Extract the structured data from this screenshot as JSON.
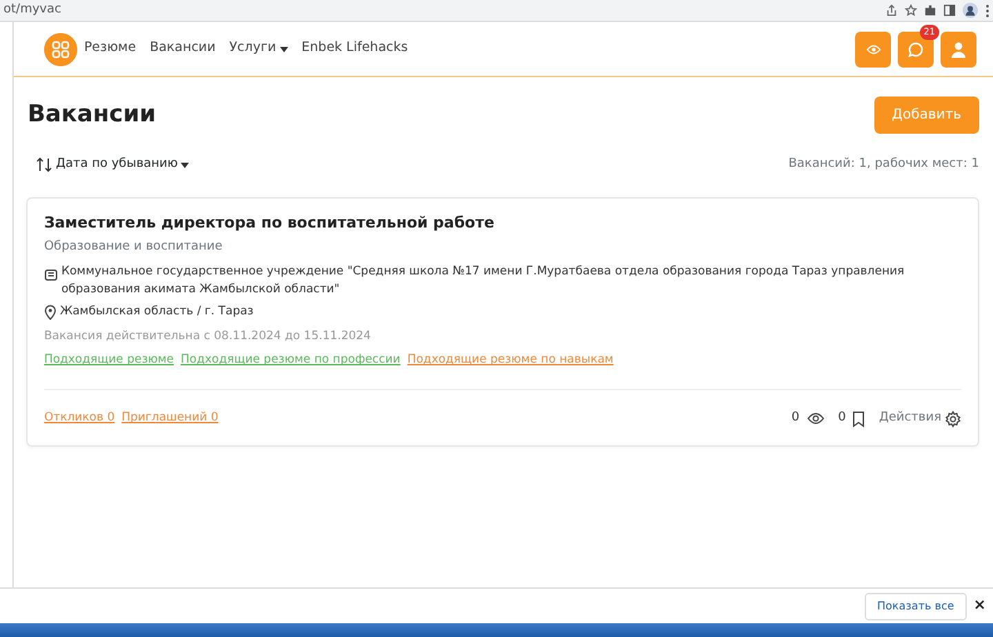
{
  "browser": {
    "url": "ot/myvac"
  },
  "nav": {
    "links": [
      {
        "label": "Резюме",
        "dropdown": false
      },
      {
        "label": "Вакансии",
        "dropdown": false
      },
      {
        "label": "Услуги",
        "dropdown": true
      },
      {
        "label": "Enbek Lifehacks",
        "dropdown": false
      }
    ],
    "message_count": "21"
  },
  "page": {
    "title": "Вакансии",
    "add_button": "Добавить",
    "sort": "Дата по убыванию",
    "summary": "Вакансий: 1, рабочих мест: 1"
  },
  "vacancy": {
    "title": "Заместитель директора по воспитательной работе",
    "category": "Образование и воспитание",
    "organization": "Коммунальное государственное учреждение \"Средняя школа №17 имени Г.Муратбаева отдела образования города Тараз управления образования акимата Жамбылской области\"",
    "location": "Жамбылская область / г. Тараз",
    "validity": "Вакансия действительна с 08.11.2024 до 15.11.2024",
    "match_links": [
      {
        "label": "Подходящие резюме",
        "color": "#5cb85c"
      },
      {
        "label": "Подходящие резюме по профессии",
        "color": "#5cb85c"
      },
      {
        "label": "Подходящие резюме по навыкам",
        "color": "#f0883a"
      }
    ],
    "responses": "Откликов 0",
    "invitations": "Приглашений 0",
    "views": "0",
    "saves": "0",
    "actions": "Действия"
  },
  "downloads_bar": {
    "show_all": "Показать все",
    "close": "×"
  }
}
